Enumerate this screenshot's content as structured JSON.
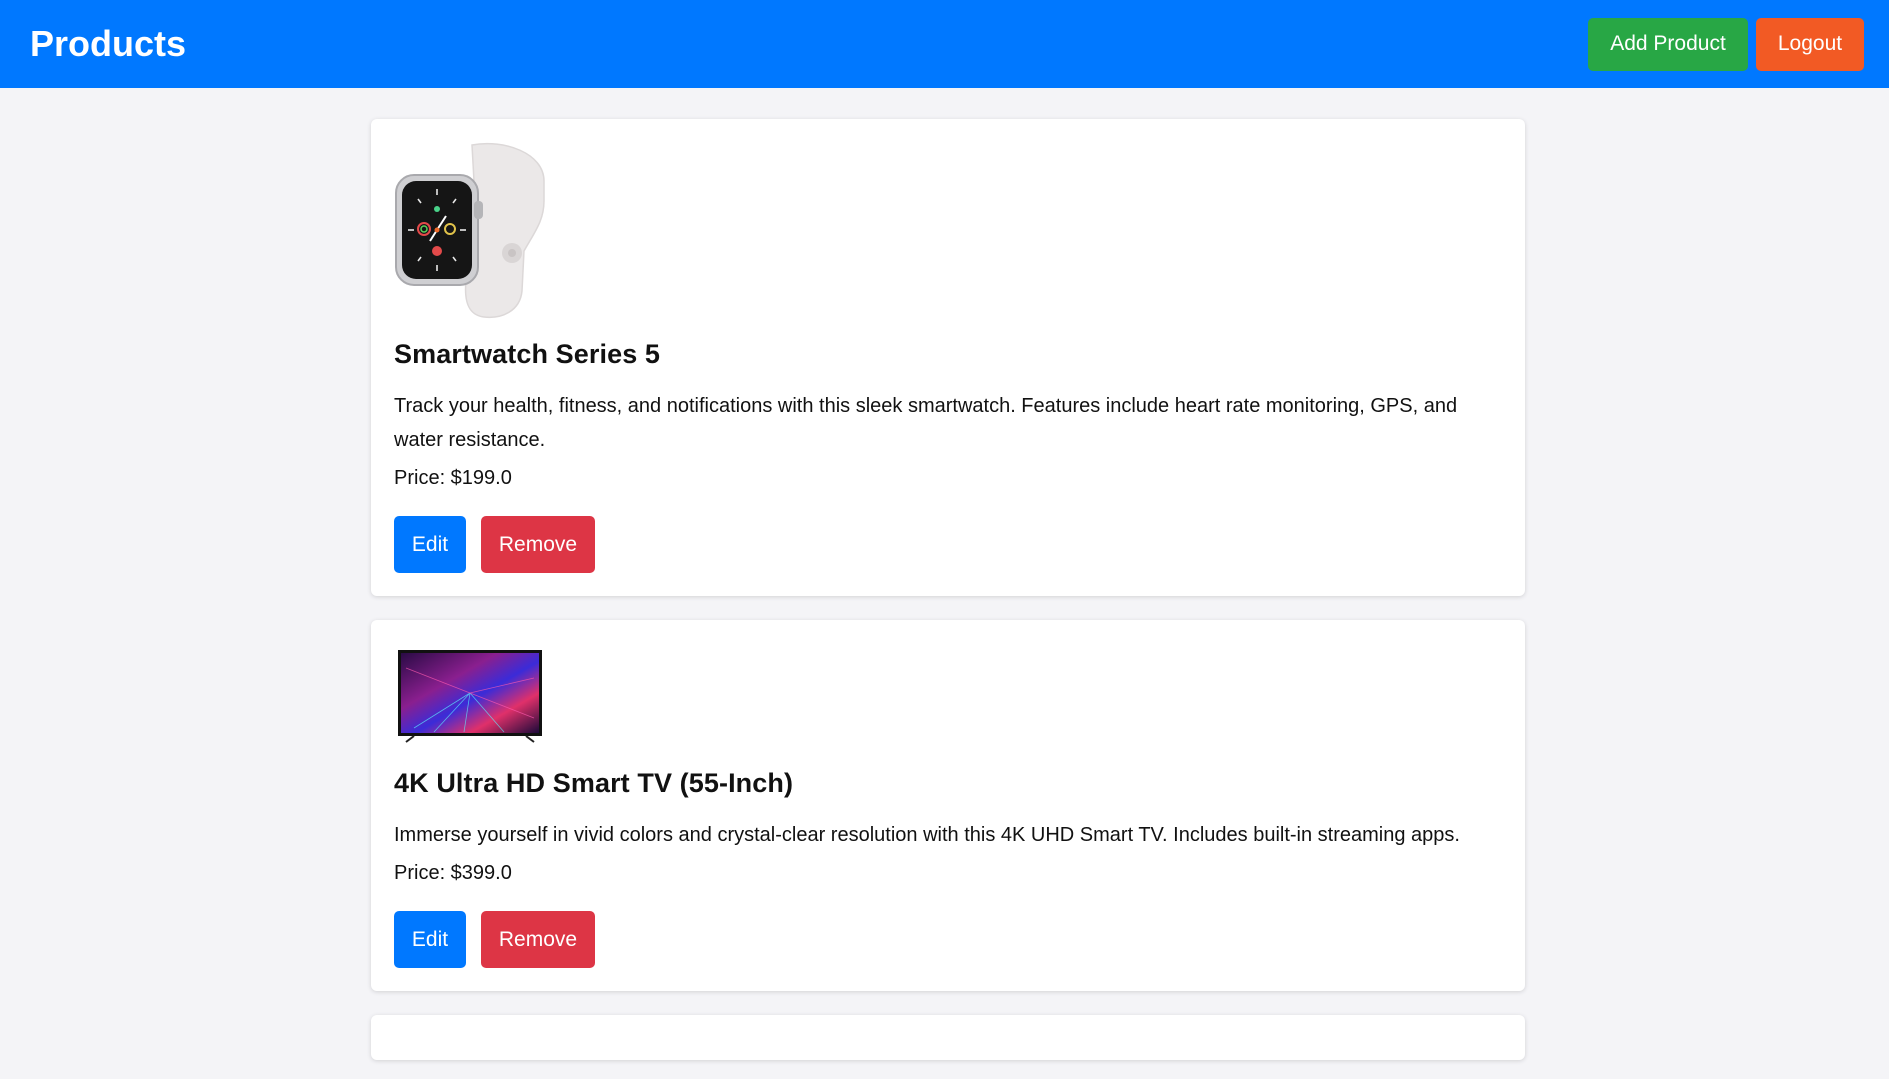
{
  "header": {
    "title": "Products",
    "add_label": "Add Product",
    "logout_label": "Logout"
  },
  "colors": {
    "header_bg": "#0078ff",
    "add": "#28a745",
    "logout": "#f25a24",
    "edit": "#0078ff",
    "remove": "#dd3545"
  },
  "products": [
    {
      "name": "Smartwatch Series 5",
      "description": "Track your health, fitness, and notifications with this sleek smartwatch. Features include heart rate monitoring, GPS, and water resistance.",
      "price": "Price: $199.0",
      "edit_label": "Edit",
      "remove_label": "Remove"
    },
    {
      "name": "4K Ultra HD Smart TV (55-Inch)",
      "description": "Immerse yourself in vivid colors and crystal-clear resolution with this 4K UHD Smart TV. Includes built-in streaming apps.",
      "price": "Price: $399.0",
      "edit_label": "Edit",
      "remove_label": "Remove"
    }
  ]
}
